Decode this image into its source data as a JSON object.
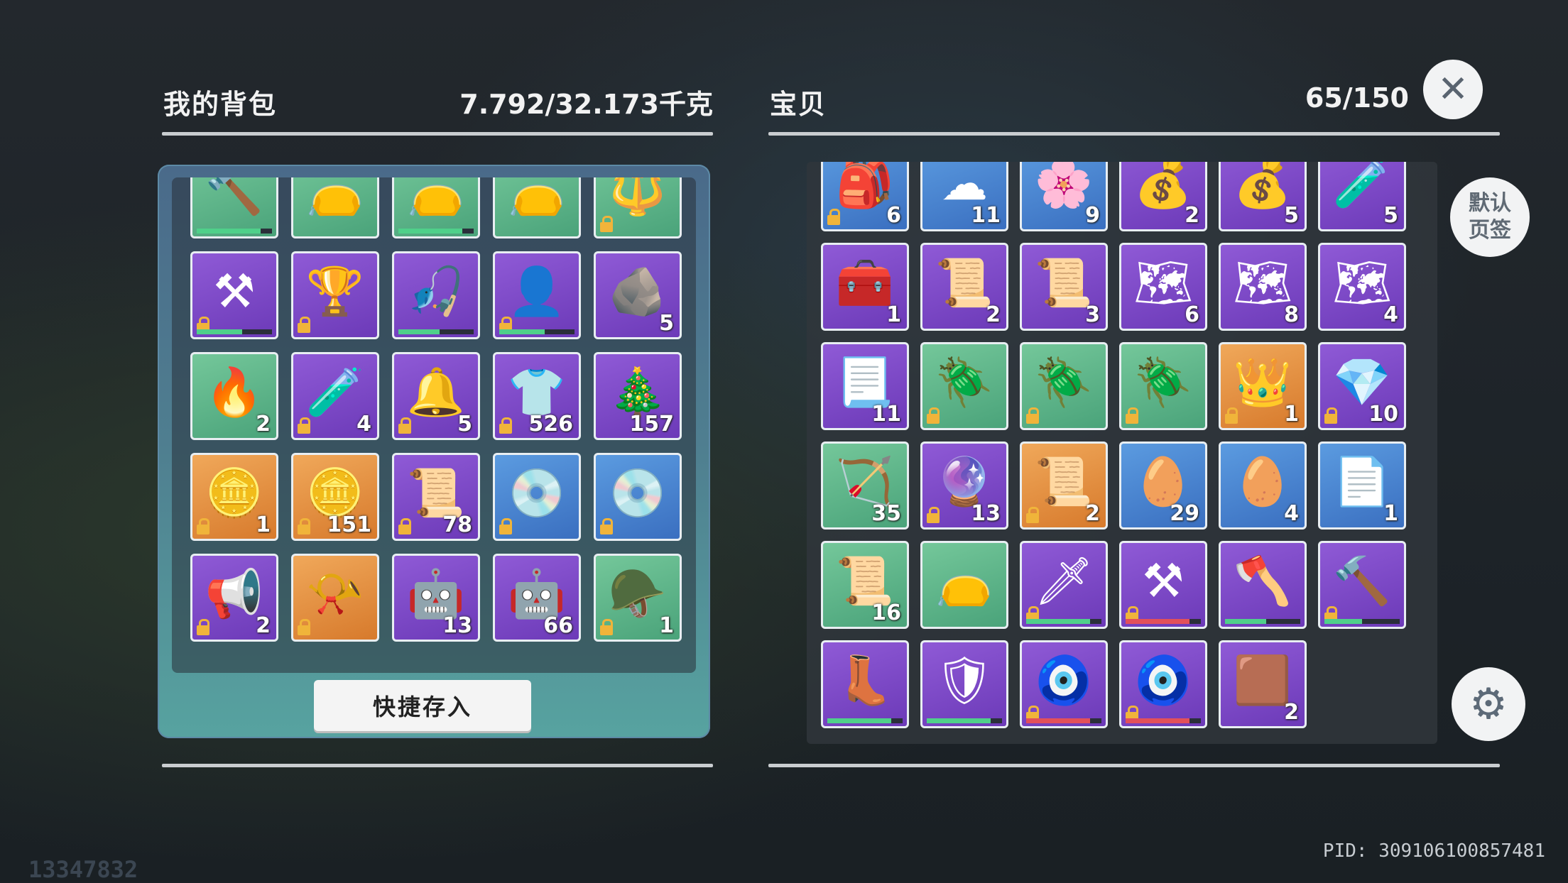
{
  "backpack": {
    "title": "我的背包",
    "weight": "7.792/32.173千克",
    "quick_store_label": "快捷存入",
    "items": [
      {
        "rarity": "green",
        "icon": "hammer-icon",
        "glyph": "🔨",
        "count": "",
        "locked": false,
        "bar": 0.85
      },
      {
        "rarity": "green",
        "icon": "pouch-icon",
        "glyph": "👝",
        "count": "",
        "locked": false,
        "bar": 0
      },
      {
        "rarity": "green",
        "icon": "pouch-icon",
        "glyph": "👝",
        "count": "",
        "locked": false,
        "bar": 0.85
      },
      {
        "rarity": "green",
        "icon": "pouch-icon",
        "glyph": "👝",
        "count": "",
        "locked": false,
        "bar": 0
      },
      {
        "rarity": "green",
        "icon": "staff-icon",
        "glyph": "🔱",
        "count": "",
        "locked": true,
        "bar": 0
      },
      {
        "rarity": "purple",
        "icon": "scythe-icon",
        "glyph": "⚒",
        "count": "",
        "locked": true,
        "bar": 0.6
      },
      {
        "rarity": "purple",
        "icon": "goblet-staff-icon",
        "glyph": "🏆",
        "count": "",
        "locked": true,
        "bar": 0
      },
      {
        "rarity": "purple",
        "icon": "fishing-rod-icon",
        "glyph": "🎣",
        "count": "",
        "locked": false,
        "bar": 0.55
      },
      {
        "rarity": "purple",
        "icon": "hair-icon",
        "glyph": "👤",
        "count": "",
        "locked": true,
        "bar": 0.6
      },
      {
        "rarity": "purple",
        "icon": "rock-icon",
        "glyph": "🪨",
        "count": "5",
        "locked": false,
        "bar": 0
      },
      {
        "rarity": "green",
        "icon": "fire-icon",
        "glyph": "🔥",
        "count": "2",
        "locked": false,
        "bar": 0
      },
      {
        "rarity": "purple",
        "icon": "paint-jar-icon",
        "glyph": "🧪",
        "count": "4",
        "locked": true,
        "bar": 0
      },
      {
        "rarity": "purple",
        "icon": "bell-icon",
        "glyph": "🔔",
        "count": "5",
        "locked": true,
        "bar": 0
      },
      {
        "rarity": "purple",
        "icon": "shirt-icon",
        "glyph": "👕",
        "count": "526",
        "locked": true,
        "bar": 0
      },
      {
        "rarity": "purple",
        "icon": "wreath-icon",
        "glyph": "🎄",
        "count": "157",
        "locked": false,
        "bar": 0
      },
      {
        "rarity": "orange",
        "icon": "coin-icon",
        "glyph": "🪙",
        "count": "1",
        "locked": true,
        "bar": 0
      },
      {
        "rarity": "orange",
        "icon": "bow-coin-icon",
        "glyph": "🪙",
        "count": "151",
        "locked": true,
        "bar": 0
      },
      {
        "rarity": "purple",
        "icon": "wanted-poster-icon",
        "glyph": "📜",
        "count": "78",
        "locked": true,
        "bar": 0
      },
      {
        "rarity": "blue",
        "icon": "disc-icon",
        "glyph": "💿",
        "count": "",
        "locked": true,
        "bar": 0
      },
      {
        "rarity": "blue",
        "icon": "disc-icon",
        "glyph": "💿",
        "count": "",
        "locked": true,
        "bar": 0
      },
      {
        "rarity": "purple",
        "icon": "megaphone-icon",
        "glyph": "📢",
        "count": "2",
        "locked": true,
        "bar": 0
      },
      {
        "rarity": "orange",
        "icon": "horn-icon",
        "glyph": "📯",
        "count": "",
        "locked": true,
        "bar": 0
      },
      {
        "rarity": "purple",
        "icon": "robot-phone-icon",
        "glyph": "🤖",
        "count": "13",
        "locked": false,
        "bar": 0
      },
      {
        "rarity": "purple",
        "icon": "robot-phone-icon",
        "glyph": "🤖",
        "count": "66",
        "locked": false,
        "bar": 0
      },
      {
        "rarity": "green",
        "icon": "saddle-icon",
        "glyph": "🪖",
        "count": "1",
        "locked": true,
        "bar": 0
      }
    ]
  },
  "storage": {
    "title": "宝贝",
    "capacity": "65/150",
    "items": [
      {
        "rarity": "blue",
        "icon": "bag-icon",
        "glyph": "🎒",
        "count": "6",
        "locked": true,
        "bar": 0
      },
      {
        "rarity": "blue",
        "icon": "cotton-icon",
        "glyph": "☁",
        "count": "11",
        "locked": false,
        "bar": 0
      },
      {
        "rarity": "blue",
        "icon": "flower-icon",
        "glyph": "🌸",
        "count": "9",
        "locked": false,
        "bar": 0
      },
      {
        "rarity": "purple",
        "icon": "seed-sack-icon",
        "glyph": "💰",
        "count": "2",
        "locked": false,
        "bar": 0
      },
      {
        "rarity": "purple",
        "icon": "seed-sack-icon",
        "glyph": "💰",
        "count": "5",
        "locked": false,
        "bar": 0
      },
      {
        "rarity": "purple",
        "icon": "potion-icon",
        "glyph": "🧪",
        "count": "5",
        "locked": false,
        "bar": 0
      },
      {
        "rarity": "purple",
        "icon": "chest-icon",
        "glyph": "🧰",
        "count": "1",
        "locked": false,
        "bar": 0
      },
      {
        "rarity": "purple",
        "icon": "scroll-icon",
        "glyph": "📜",
        "count": "2",
        "locked": false,
        "bar": 0
      },
      {
        "rarity": "purple",
        "icon": "scroll-icon",
        "glyph": "📜",
        "count": "3",
        "locked": false,
        "bar": 0
      },
      {
        "rarity": "purple",
        "icon": "blue-scroll-icon",
        "glyph": "🗺",
        "count": "6",
        "locked": false,
        "bar": 0
      },
      {
        "rarity": "purple",
        "icon": "blue-scroll-icon",
        "glyph": "🗺",
        "count": "8",
        "locked": false,
        "bar": 0
      },
      {
        "rarity": "purple",
        "icon": "blue-scroll-icon",
        "glyph": "🗺",
        "count": "4",
        "locked": false,
        "bar": 0
      },
      {
        "rarity": "purple",
        "icon": "blueprint-icon",
        "glyph": "📃",
        "count": "11",
        "locked": false,
        "bar": 0
      },
      {
        "rarity": "green",
        "icon": "beetle-icon",
        "glyph": "🪲",
        "count": "",
        "locked": true,
        "bar": 0
      },
      {
        "rarity": "green",
        "icon": "beetle-icon",
        "glyph": "🪲",
        "count": "",
        "locked": true,
        "bar": 0
      },
      {
        "rarity": "green",
        "icon": "beetle-icon",
        "glyph": "🪲",
        "count": "",
        "locked": true,
        "bar": 0
      },
      {
        "rarity": "orange",
        "icon": "crown-card-icon",
        "glyph": "👑",
        "count": "1",
        "locked": true,
        "bar": 0
      },
      {
        "rarity": "purple",
        "icon": "crystal-icon",
        "glyph": "💎",
        "count": "10",
        "locked": true,
        "bar": 0
      },
      {
        "rarity": "green",
        "icon": "arrows-icon",
        "glyph": "🏹",
        "count": "35",
        "locked": false,
        "bar": 0
      },
      {
        "rarity": "purple",
        "icon": "gem-icon",
        "glyph": "🔮",
        "count": "13",
        "locked": true,
        "bar": 0
      },
      {
        "rarity": "orange",
        "icon": "map-scroll-icon",
        "glyph": "📜",
        "count": "2",
        "locked": true,
        "bar": 0
      },
      {
        "rarity": "blue",
        "icon": "egg-icon",
        "glyph": "🥚",
        "count": "29",
        "locked": false,
        "bar": 0
      },
      {
        "rarity": "blue",
        "icon": "egg-icon",
        "glyph": "🥚",
        "count": "4",
        "locked": false,
        "bar": 0
      },
      {
        "rarity": "blue",
        "icon": "paper-icon",
        "glyph": "📄",
        "count": "1",
        "locked": false,
        "bar": 0
      },
      {
        "rarity": "green",
        "icon": "parchment-icon",
        "glyph": "📜",
        "count": "16",
        "locked": false,
        "bar": 0
      },
      {
        "rarity": "green",
        "icon": "pouch-icon",
        "glyph": "👝",
        "count": "",
        "locked": false,
        "bar": 0
      },
      {
        "rarity": "purple",
        "icon": "spear-icon",
        "glyph": "🗡",
        "count": "",
        "locked": true,
        "bar": 0.85
      },
      {
        "rarity": "purple",
        "icon": "scythe-icon",
        "glyph": "⚒",
        "count": "",
        "locked": true,
        "bar": 0.85
      },
      {
        "rarity": "purple",
        "icon": "ice-axe-icon",
        "glyph": "🪓",
        "count": "",
        "locked": false,
        "bar": 0.55
      },
      {
        "rarity": "purple",
        "icon": "fire-hammer-icon",
        "glyph": "🔨",
        "count": "",
        "locked": true,
        "bar": 0.5
      },
      {
        "rarity": "purple",
        "icon": "boots-icon",
        "glyph": "👢",
        "count": "",
        "locked": false,
        "bar": 0.85
      },
      {
        "rarity": "purple",
        "icon": "armor-icon",
        "glyph": "🛡",
        "count": "",
        "locked": false,
        "bar": 0.85
      },
      {
        "rarity": "purple",
        "icon": "amulet-icon",
        "glyph": "🧿",
        "count": "",
        "locked": true,
        "bar": 0.85
      },
      {
        "rarity": "purple",
        "icon": "amulet-icon",
        "glyph": "🧿",
        "count": "",
        "locked": true,
        "bar": 0.85
      },
      {
        "rarity": "purple",
        "icon": "paper-sheet-icon",
        "glyph": "🟫",
        "count": "2",
        "locked": false,
        "bar": 0
      }
    ]
  },
  "buttons": {
    "close_glyph": "✕",
    "default_tab_line1": "默认",
    "default_tab_line2": "页签",
    "settings_glyph": "⚙"
  },
  "footer": {
    "left_id": "13347832",
    "pid": "PID: 309106100857481"
  },
  "colors": {
    "bar_green": "#4fd08a",
    "bar_red": "#e2505a",
    "bar_purple": "#6a3fb0"
  }
}
